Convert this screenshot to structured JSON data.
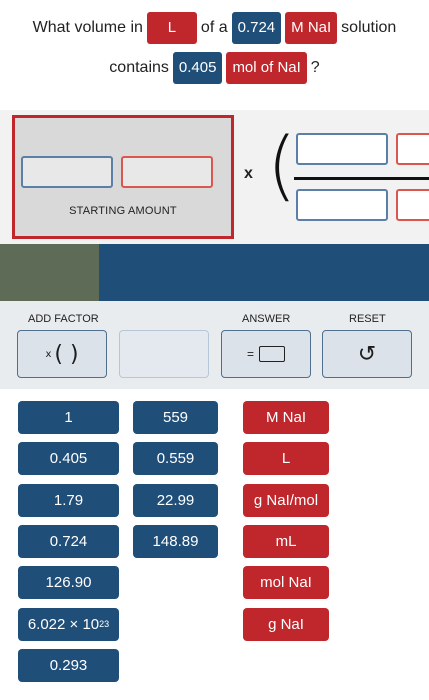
{
  "question": {
    "prefix": "What volume in",
    "unit_chip": "L",
    "of_a": "of a",
    "concentration_value": "0.724",
    "concentration_unit": "M NaI",
    "solution_word": "solution",
    "contains": "contains",
    "amount_value": "0.405",
    "amount_unit": "mol of NaI",
    "question_mark": "?"
  },
  "workspace": {
    "starting_amount_label": "STARTING AMOUNT",
    "multiply_sign": "x",
    "open_paren": "("
  },
  "progress": {
    "fraction": 0.23
  },
  "toolbar": {
    "add_factor_label": "ADD FACTOR",
    "add_factor_glyph": "( )",
    "add_factor_x": "x",
    "answer_label": "ANSWER",
    "answer_equals": "=",
    "reset_label": "RESET",
    "reset_glyph": "↺"
  },
  "tiles": {
    "col1": [
      "1",
      "0.405",
      "1.79",
      "0.724",
      "126.90",
      "6.022 × 10",
      "0.293"
    ],
    "avogadro_exponent": "23",
    "col2": [
      "559",
      "0.559",
      "22.99",
      "148.89"
    ],
    "col3": [
      "M NaI",
      "L",
      "g NaI/mol",
      "mL",
      "mol NaI",
      "g NaI"
    ]
  },
  "colors": {
    "accent_red": "#c0272d",
    "accent_blue": "#1f4e79",
    "progress_done": "#5e6b57"
  }
}
